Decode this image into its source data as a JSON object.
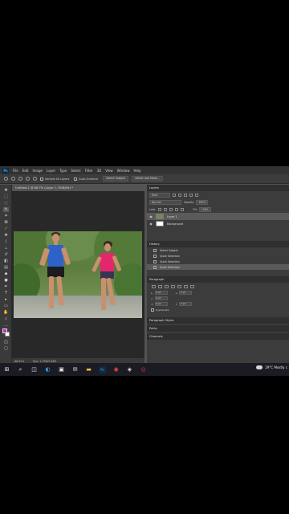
{
  "app": {
    "logo_text": "Ps",
    "menu": [
      "File",
      "Edit",
      "Image",
      "Layer",
      "Type",
      "Select",
      "Filter",
      "3D",
      "View",
      "Window",
      "Help"
    ]
  },
  "options_bar": {
    "sample_all_layers": "Sample All Layers",
    "auto_enhance": "Auto-Enhance",
    "select_subject": "Select Subject",
    "select_and_mask": "Select and Mask..."
  },
  "document": {
    "tab_title": "Untitled-1 @ 66.7% (Layer 1, RGB/8#) *",
    "zoom": "66.67%",
    "doc_size": "Doc: 1.37M/2.65M"
  },
  "colors": {
    "foreground": "#c62fc0",
    "background": "#ffffff",
    "ui_dark": "#3c3c3c",
    "ui_mid": "#535353"
  },
  "layers_panel": {
    "title": "Layers",
    "kind_label": "Kind",
    "blend_mode": "Normal",
    "opacity_label": "Opacity:",
    "opacity_value": "100%",
    "lock_label": "Lock:",
    "fill_label": "Fill:",
    "fill_value": "100%",
    "layers": [
      {
        "name": "Layer 1",
        "selected": true
      },
      {
        "name": "Background",
        "selected": false
      }
    ]
  },
  "history_panel": {
    "title": "History",
    "items": [
      {
        "label": "Select Subject",
        "selected": false
      },
      {
        "label": "Quick Selection",
        "selected": false
      },
      {
        "label": "Quick Selection",
        "selected": false
      },
      {
        "label": "Quick Selection",
        "selected": true
      }
    ]
  },
  "paragraph_panel": {
    "title": "Paragraph",
    "left_indent": "0 pt",
    "right_indent": "0 pt",
    "first_line": "0 pt",
    "space_before": "0 pt",
    "space_after": "0 pt",
    "hyphenate": "Hyphenate"
  },
  "collapsed_panels": [
    "Paragraph Styles",
    "Paths",
    "Channels"
  ],
  "taskbar": {
    "icons": [
      "windows-start-icon",
      "search-icon",
      "task-view-icon",
      "edge-icon",
      "store-icon",
      "mail-icon",
      "file-explorer-icon",
      "photoshop-icon",
      "chrome-icon",
      "app-icon",
      "app-icon-2"
    ],
    "photoshop_label": "Ps",
    "weather_text": "29°C  Mostly c"
  }
}
